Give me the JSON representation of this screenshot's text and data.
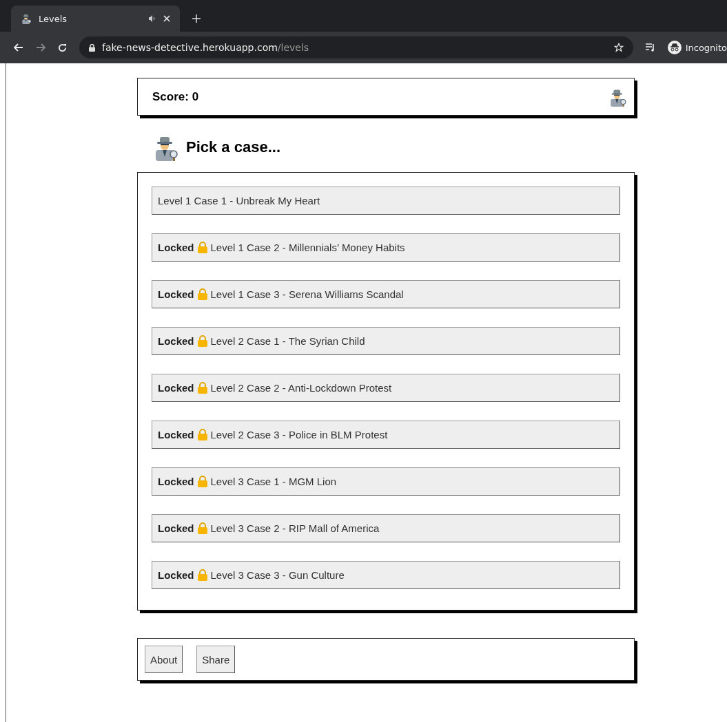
{
  "browser": {
    "tab_title": "Levels",
    "url_host": "fake-news-detective.herokuapp.com",
    "url_path": "/levels",
    "profile_label": "Incognito"
  },
  "score": {
    "label": "Score: 0"
  },
  "heading": "Pick a case...",
  "cases": [
    {
      "locked": false,
      "title": "Level 1 Case 1 - Unbreak My Heart"
    },
    {
      "locked": true,
      "locked_label": "Locked",
      "title": "Level 1 Case 2 - Millennials’ Money Habits"
    },
    {
      "locked": true,
      "locked_label": "Locked",
      "title": "Level 1 Case 3 - Serena Williams Scandal"
    },
    {
      "locked": true,
      "locked_label": "Locked",
      "title": "Level 2 Case 1 - The Syrian Child"
    },
    {
      "locked": true,
      "locked_label": "Locked",
      "title": "Level 2 Case 2 - Anti-Lockdown Protest"
    },
    {
      "locked": true,
      "locked_label": "Locked",
      "title": "Level 2 Case 3 - Police in BLM Protest"
    },
    {
      "locked": true,
      "locked_label": "Locked",
      "title": "Level 3 Case 1 - MGM Lion"
    },
    {
      "locked": true,
      "locked_label": "Locked",
      "title": "Level 3 Case 2 - RIP Mall of America"
    },
    {
      "locked": true,
      "locked_label": "Locked",
      "title": "Level 3 Case 3 - Gun Culture"
    }
  ],
  "footer_buttons": [
    "About",
    "Share"
  ]
}
